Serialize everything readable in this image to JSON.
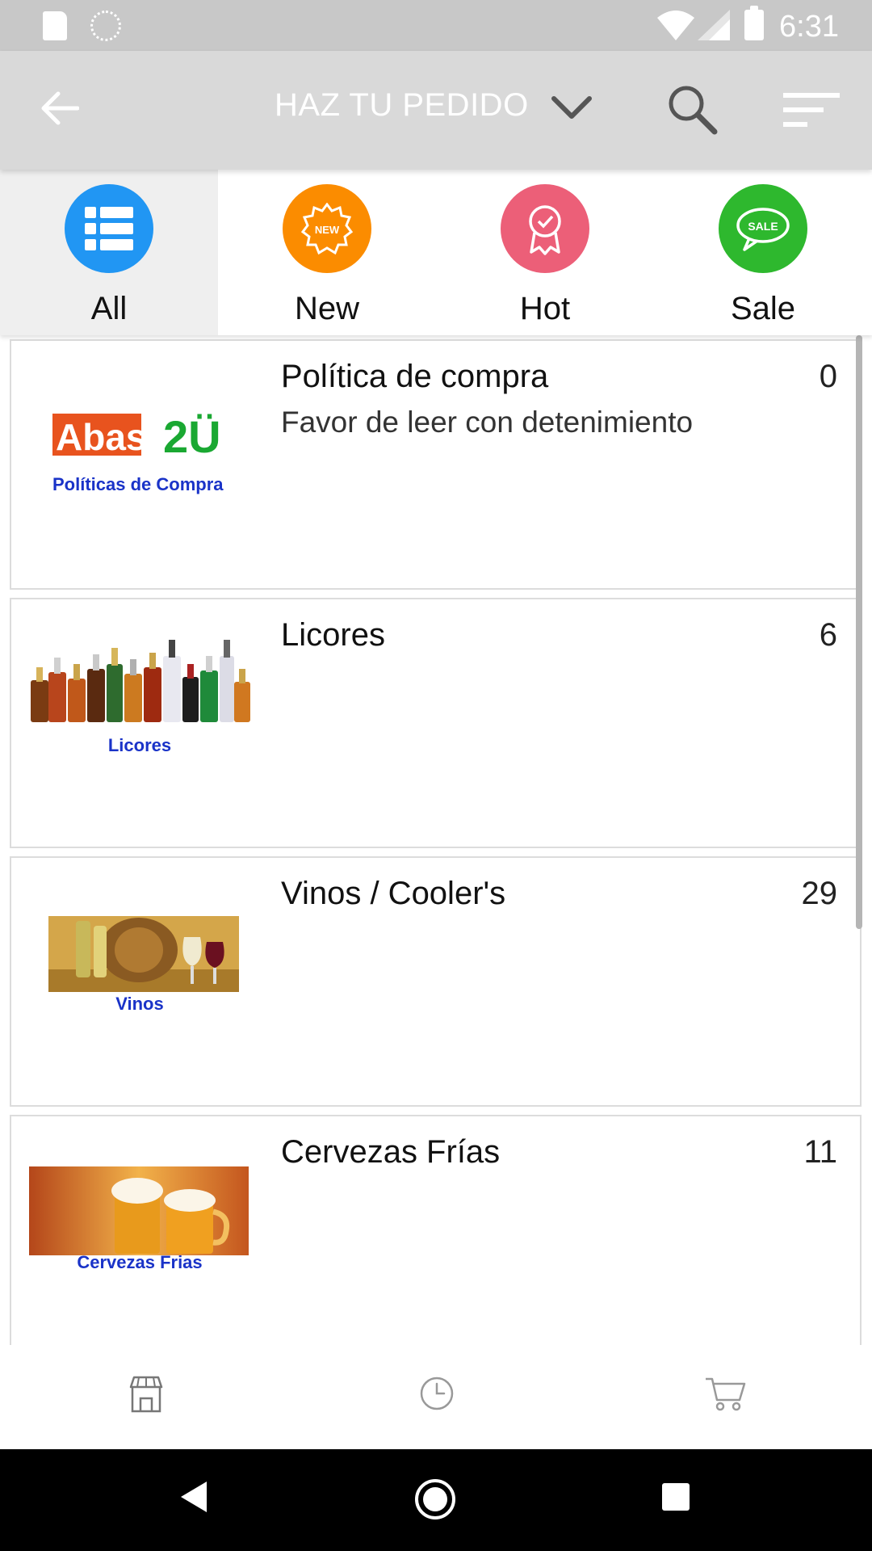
{
  "status_bar": {
    "time": "6:31"
  },
  "app_bar": {
    "title": "HAZ TU PEDIDO"
  },
  "filter_tabs": [
    {
      "label": "All",
      "icon": "list-icon",
      "color": "#2196f3"
    },
    {
      "label": "New",
      "icon": "new-badge-icon",
      "color": "#fb8c00"
    },
    {
      "label": "Hot",
      "icon": "award-icon",
      "color": "#ec5f78"
    },
    {
      "label": "Sale",
      "icon": "sale-bubble-icon",
      "color": "#2eb82e"
    }
  ],
  "categories": [
    {
      "name": "Política de compra",
      "description": "Favor de leer con detenimiento",
      "count": "0",
      "logo": {
        "brand_a": "Abast",
        "brand_b": "2Ü",
        "caption": "Políticas de Compra"
      }
    },
    {
      "name": "Licores",
      "description": "",
      "count": "6",
      "caption": "Licores"
    },
    {
      "name": "Vinos / Cooler's",
      "description": "",
      "count": "29",
      "caption": "Vinos"
    },
    {
      "name": "Cervezas Frías",
      "description": "",
      "count": "11",
      "caption": "Cervezas Frias"
    }
  ],
  "bottom_nav": [
    {
      "icon": "store-icon"
    },
    {
      "icon": "history-clock-icon"
    },
    {
      "icon": "cart-icon"
    }
  ],
  "colors": {
    "accent_blue": "#2196f3",
    "caption_blue": "#1a33c8",
    "logo_orange": "#e8531e",
    "logo_green": "#1aa832"
  }
}
